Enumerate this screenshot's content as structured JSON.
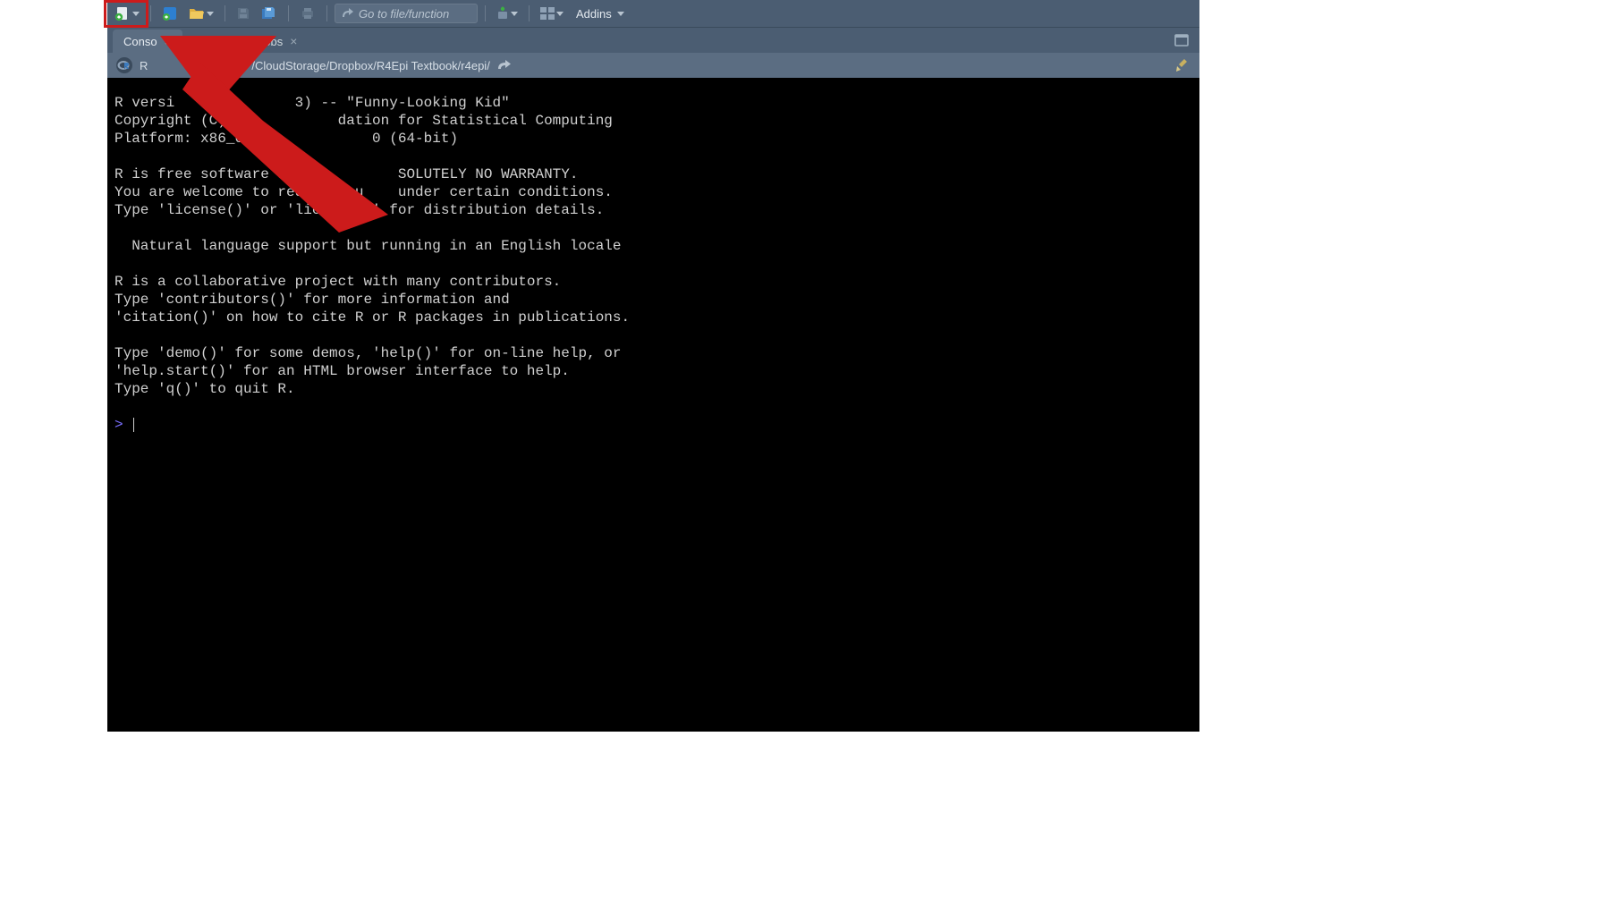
{
  "toolbar": {
    "goto_placeholder": "Go to file/function",
    "addins_label": "Addins"
  },
  "tabs": [
    {
      "label": "Conso",
      "closable": true,
      "active": true
    },
    {
      "label": "Background Jobs",
      "closable": true,
      "active": false
    }
  ],
  "path_row": {
    "r_letter": "R",
    "path": "/CloudStorage/Dropbox/R4Epi Textbook/r4epi/"
  },
  "console": {
    "lines": [
      "R versi              3) -- \"Funny-Looking Kid\"",
      "Copyright (C)             dation for Statistical Computing",
      "Platform: x86_64-a            0 (64-bit)",
      "",
      "R is free software and co        SOLUTELY NO WARRANTY.",
      "You are welcome to redistribu    under certain conditions.",
      "Type 'license()' or 'licence()' for distribution details.",
      "",
      "  Natural language support but running in an English locale",
      "",
      "R is a collaborative project with many contributors.",
      "Type 'contributors()' for more information and",
      "'citation()' on how to cite R or R packages in publications.",
      "",
      "Type 'demo()' for some demos, 'help()' for on-line help, or",
      "'help.start()' for an HTML browser interface to help.",
      "Type 'q()' to quit R.",
      ""
    ],
    "prompt": ">"
  },
  "annotation": {
    "description": "Red rectangle highlighting the New File toolbar button with a large red arrow pointing to it"
  }
}
